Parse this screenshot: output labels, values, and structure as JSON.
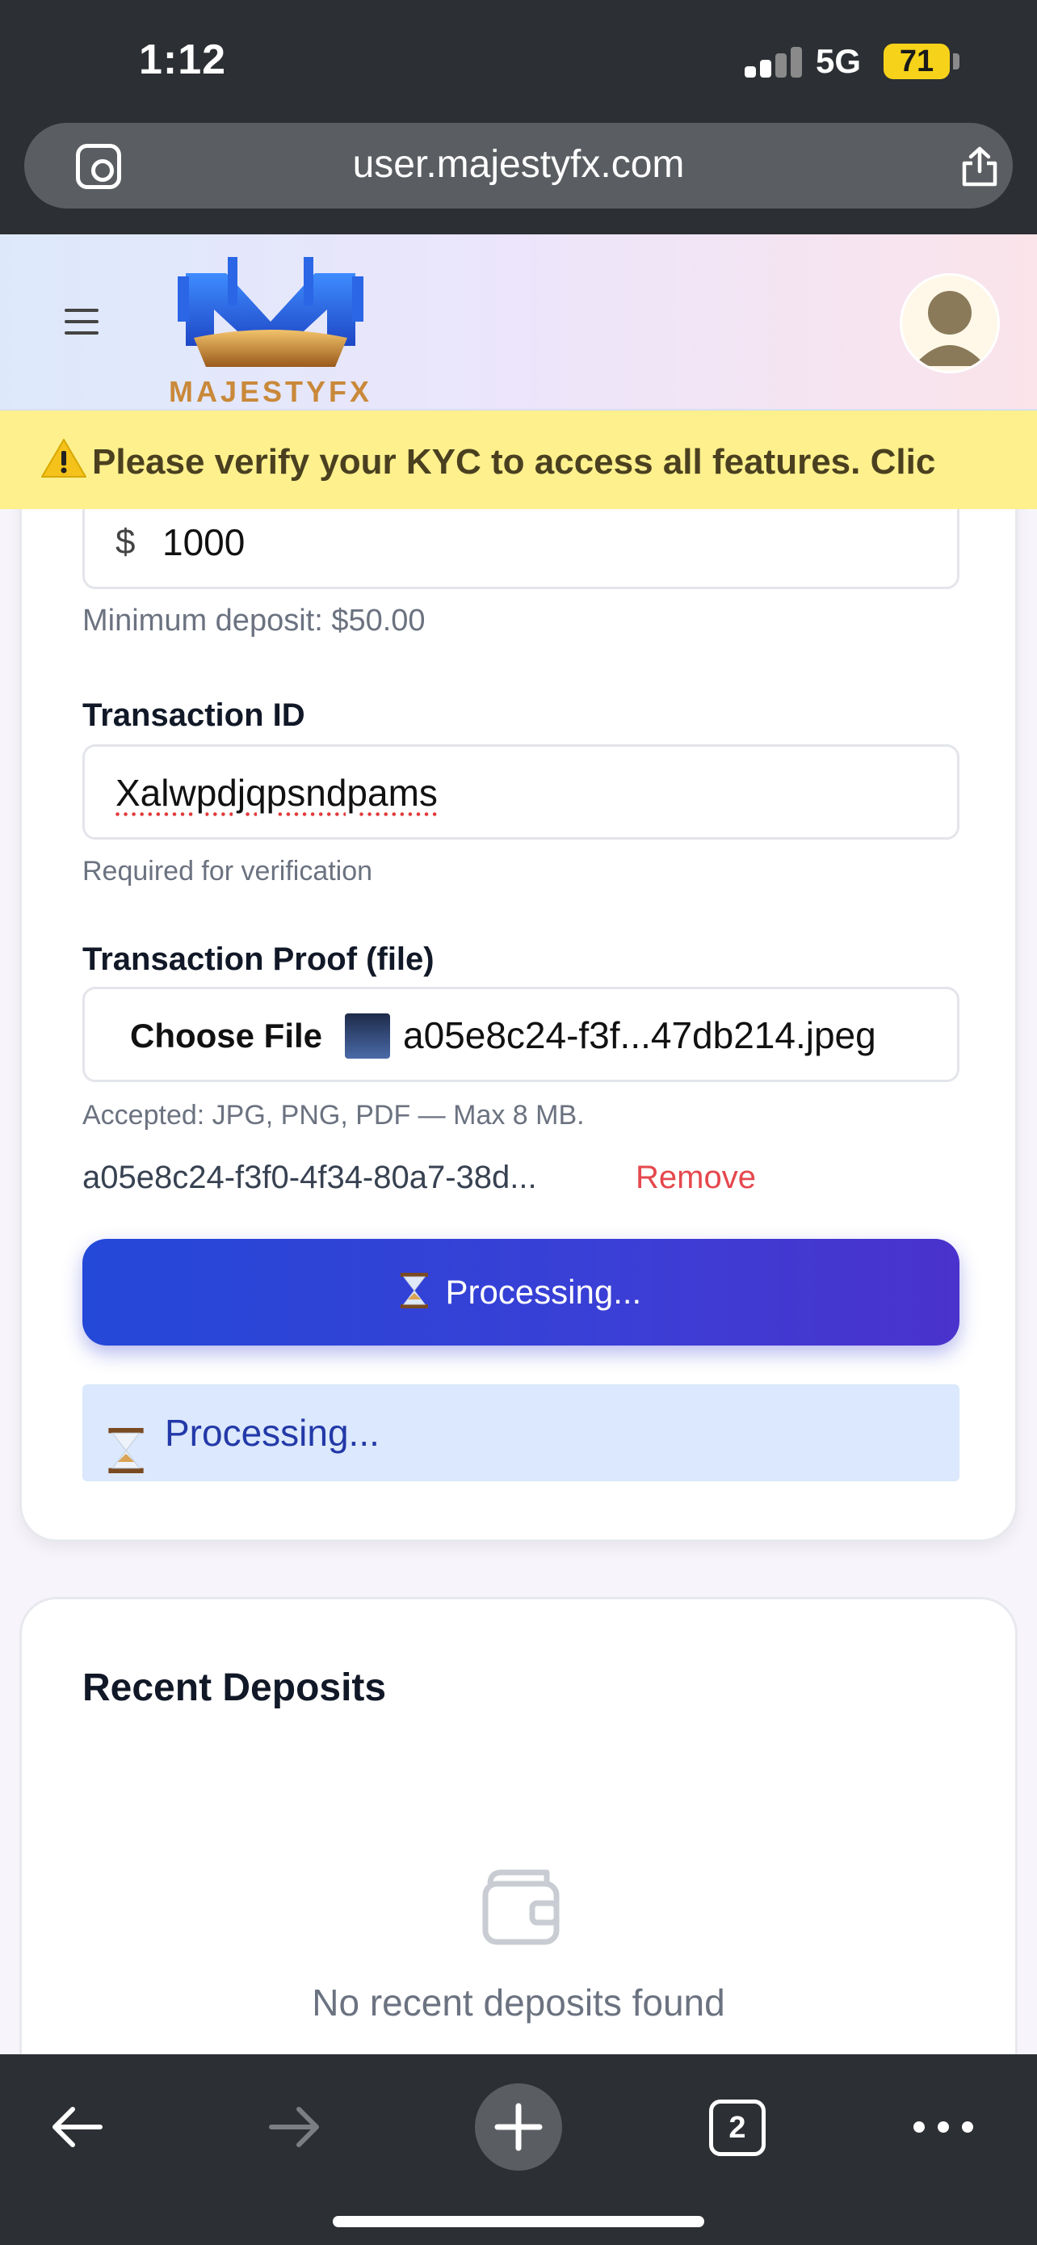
{
  "status_bar": {
    "time": "1:12",
    "network": "5G",
    "battery": "71"
  },
  "browser": {
    "url": "user.majestyfx.com",
    "tab_count": "2"
  },
  "site": {
    "logo_text": "MAJESTYFX"
  },
  "kyc_banner": {
    "text": "Please verify your KYC to access all features. Clic"
  },
  "deposit_form": {
    "amount": {
      "currency_symbol": "$",
      "value": "1000",
      "helper": "Minimum deposit: $50.00"
    },
    "transaction_id": {
      "label": "Transaction ID",
      "value": "Xalwpdjqpsndpams",
      "helper": "Required for verification"
    },
    "transaction_proof": {
      "label": "Transaction Proof (file)",
      "choose_file_label": "Choose File",
      "selected_file": "a05e8c24-f3f...47db214.jpeg",
      "helper": "Accepted: JPG, PNG, PDF — Max 8 MB.",
      "file_name": "a05e8c24-f3f0-4f34-80a7-38d...",
      "remove_label": "Remove"
    },
    "submit_label": "Processing...",
    "status_message": "Processing..."
  },
  "recent_deposits": {
    "title": "Recent Deposits",
    "empty_message": "No recent deposits found",
    "icon": "wallet-icon"
  },
  "colors": {
    "primary": "#2448d8",
    "banner": "#fdf08d",
    "danger": "#e5484d",
    "toolbar": "#2c2f33"
  }
}
